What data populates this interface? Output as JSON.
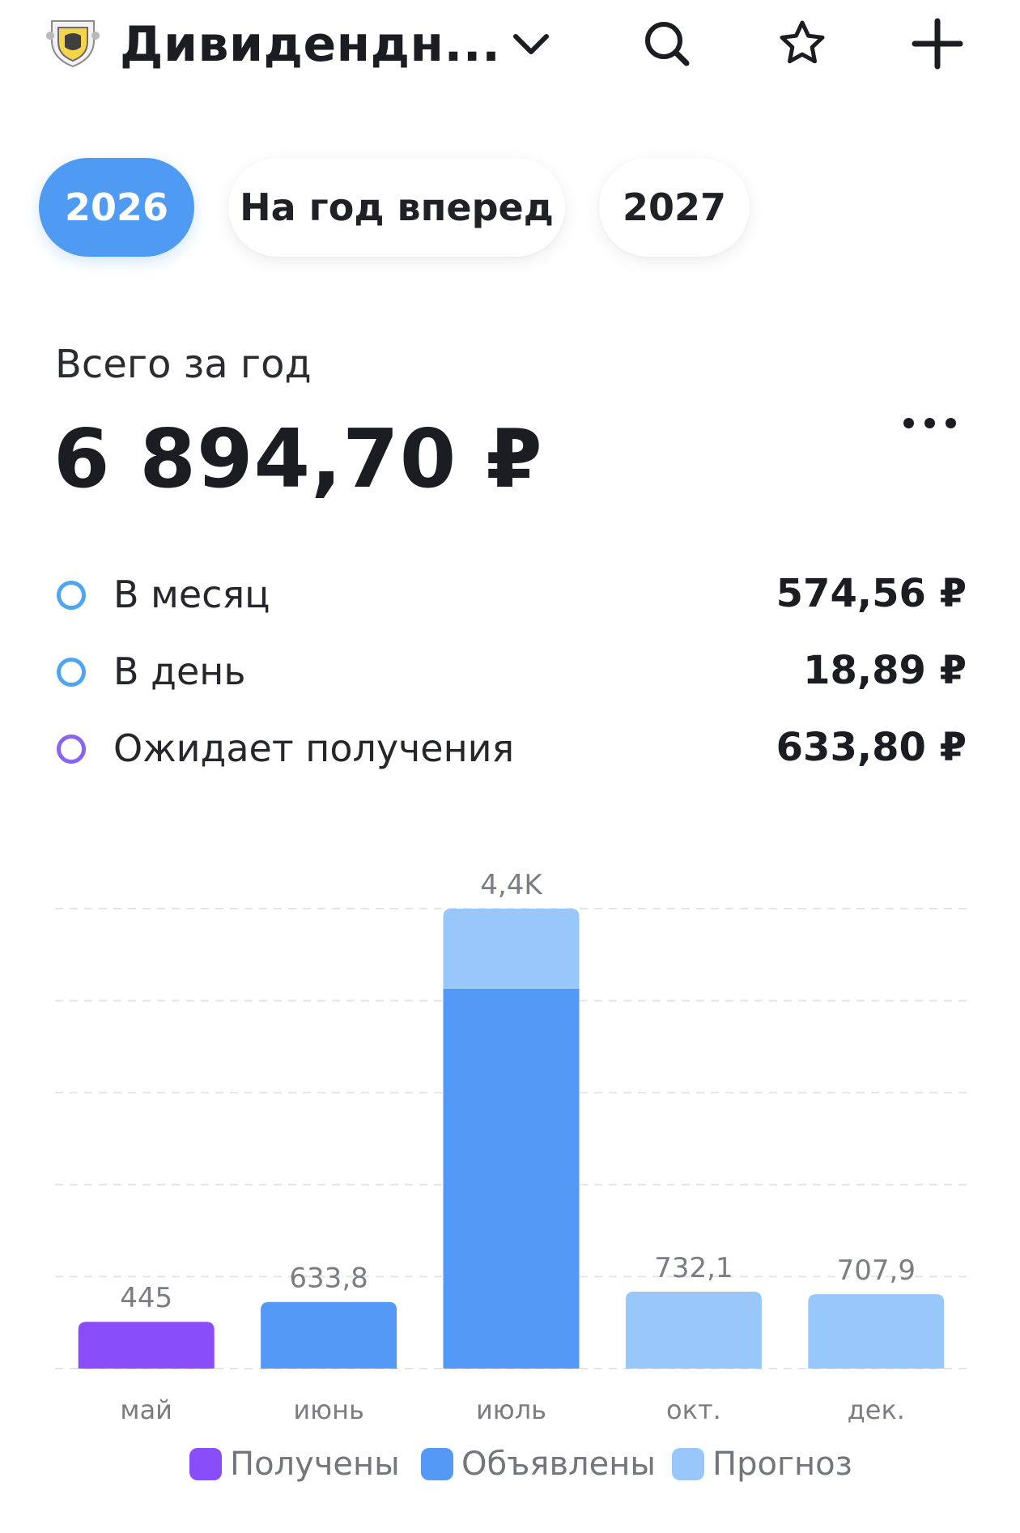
{
  "header": {
    "title": "Дивидендн...",
    "icons": [
      "chevron-down-icon",
      "search-icon",
      "star-icon",
      "plus-icon"
    ]
  },
  "tabs": [
    {
      "label": "2026",
      "active": true
    },
    {
      "label": "На год вперед",
      "active": false
    },
    {
      "label": "2027",
      "active": false
    }
  ],
  "summary": {
    "total_label": "Всего за год",
    "total_value": "6 894,70 ₽",
    "rows": [
      {
        "label": "В месяц",
        "value": "574,56 ₽",
        "dot_color": "#4fa6ef"
      },
      {
        "label": "В день",
        "value": "18,89 ₽",
        "dot_color": "#4fa6ef"
      },
      {
        "label": "Ожидает получения",
        "value": "633,80 ₽",
        "dot_color": "#8a63f0"
      }
    ]
  },
  "colors": {
    "accent": "#4f9bf3",
    "received": "#8a4dfa",
    "declared": "#5399f5",
    "forecast": "#97c7fb"
  },
  "chart_data": {
    "type": "bar",
    "stacked": true,
    "categories": [
      "май",
      "июнь",
      "июль",
      "окт.",
      "дек."
    ],
    "value_labels": [
      "445",
      "633,8",
      "4,4K",
      "732,1",
      "707,9"
    ],
    "series": [
      {
        "name": "Получены",
        "color": "#8a4dfa",
        "values": [
          445,
          0,
          0,
          0,
          0
        ]
      },
      {
        "name": "Объявлены",
        "color": "#5399f5",
        "values": [
          0,
          633.8,
          3614.8,
          0,
          0
        ]
      },
      {
        "name": "Прогноз",
        "color": "#97c7fb",
        "values": [
          0,
          0,
          761.1,
          732.1,
          707.9
        ]
      }
    ],
    "ylim": [
      0,
      4375.9
    ],
    "grid": true,
    "legend_position": "bottom"
  }
}
